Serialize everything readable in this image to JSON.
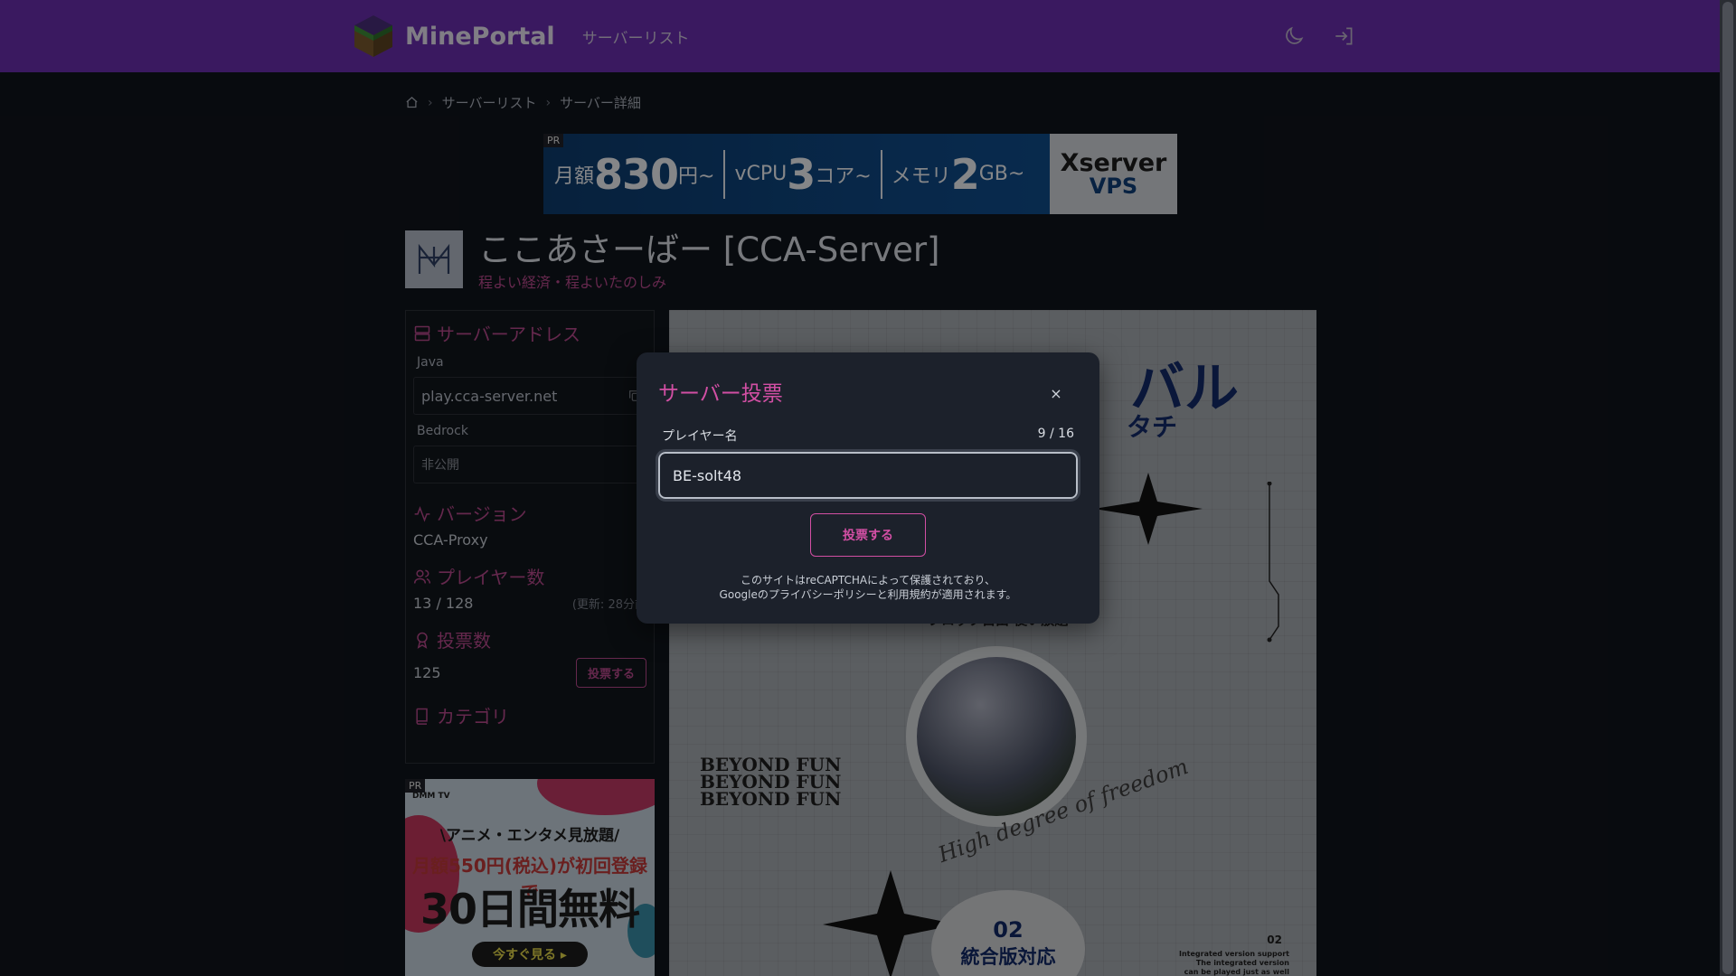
{
  "navbar": {
    "brand": "MinePortal",
    "link_server_list": "サーバーリスト"
  },
  "breadcrumb": {
    "items": [
      "サーバーリスト",
      "サーバー詳細"
    ]
  },
  "ad_top": {
    "pr": "PR",
    "part1_prefix": "月額",
    "part1_value": "830",
    "part1_suffix": "円~",
    "part2_prefix": "vCPU",
    "part2_value": "3",
    "part2_suffix": "コア~",
    "part3_prefix": "メモリ",
    "part3_value": "2",
    "part3_suffix": "GB~",
    "brand": "Xserver",
    "brand_sub": "VPS"
  },
  "server": {
    "name": "ここあさーばー [CCA-Server]",
    "tagline": "程よい経済・程よいたのしみ"
  },
  "sidebar": {
    "address_title": "サーバーアドレス",
    "java_label": "Java",
    "java_address": "play.cca-server.net",
    "bedrock_label": "Bedrock",
    "bedrock_address": "非公開",
    "version_title": "バージョン",
    "version_value": "CCA-Proxy",
    "players_title": "プレイヤー数",
    "players_value": "13 / 128",
    "players_updated": "(更新: 28分前",
    "votes_title": "投票数",
    "votes_value": "125",
    "vote_button": "投票する",
    "category_title": "カテゴリ"
  },
  "ad_side": {
    "pr": "PR",
    "logo": "DMM TV",
    "line1": "\\アニメ・エンタメ見放題/",
    "line2": "月額550円(税込)が初回登録で",
    "line3": "30日間無料",
    "button": "今すぐ見る ▸"
  },
  "banner": {
    "title": "バル",
    "subtitle": "タチ",
    "repeat_lines": [
      "BEYOND FUN",
      "BEYOND FUN",
      "BEYOND FUN"
    ],
    "circle_caption": "プロック自由 使い放題",
    "script_text": "High degree of freedom",
    "badge_num": "02",
    "badge_label": "統合版対応",
    "caption_num": "02",
    "caption_lines": [
      "Integrated version support",
      "The integrated version",
      "can be played just as well"
    ]
  },
  "modal": {
    "title": "サーバー投票",
    "close": "×",
    "player_label": "プレイヤー名",
    "char_count": "9 / 16",
    "player_value": "BE-solt48",
    "submit": "投票する",
    "recaptcha_line1": "このサイトはreCAPTCHAによって保護されており、",
    "recaptcha_line2": "Googleのプライバシーポリシーと利用規約が適用されます。"
  },
  "colors": {
    "navbar": "#6b2fb0",
    "accent": "#d24fa4",
    "background": "#10141c"
  },
  "icons": [
    "moon-icon",
    "login-icon",
    "home-icon",
    "server-icon",
    "copy-icon",
    "activity-icon",
    "users-icon",
    "award-icon",
    "book-icon",
    "close-icon"
  ]
}
